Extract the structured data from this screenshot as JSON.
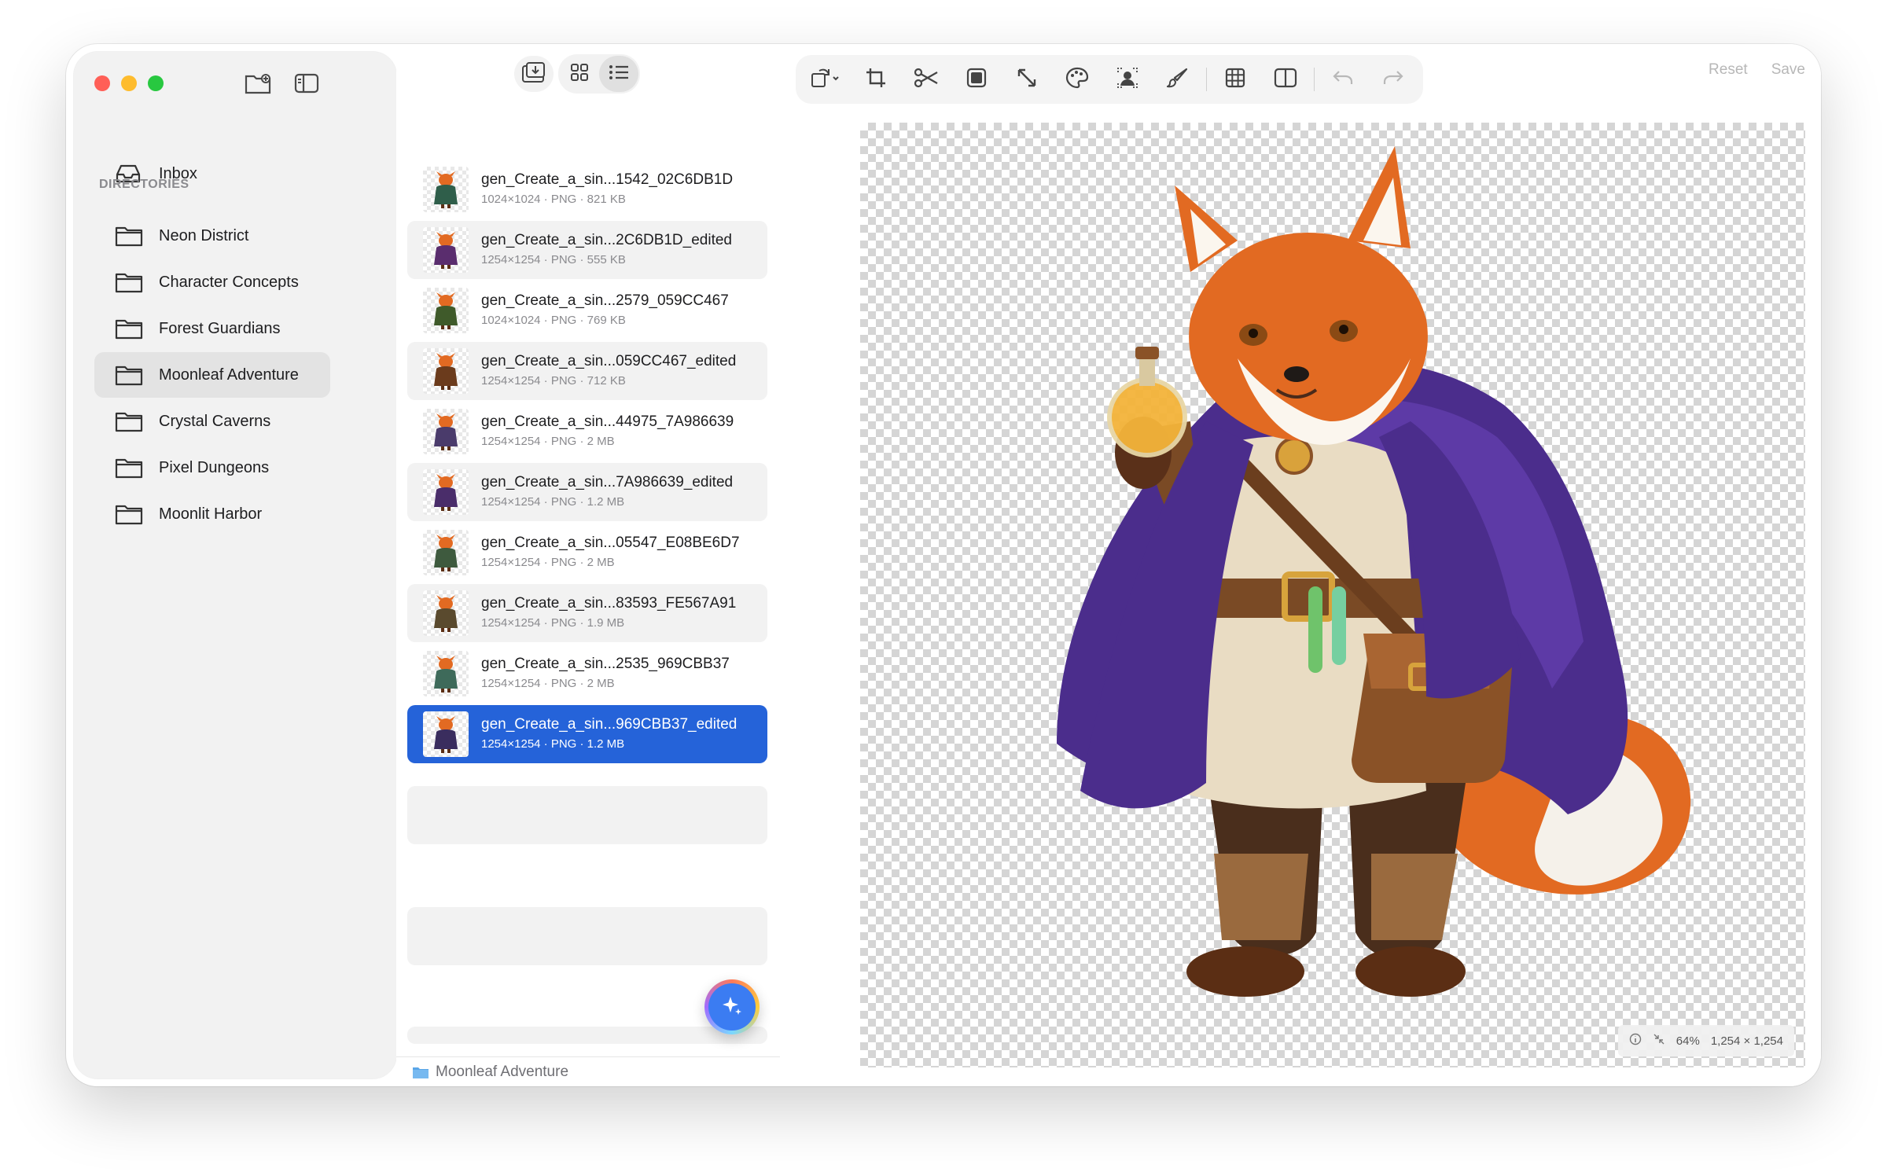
{
  "sidebar": {
    "inbox_label": "Inbox",
    "directories_header": "DIRECTORIES",
    "directories": [
      {
        "label": "Neon District"
      },
      {
        "label": "Character Concepts"
      },
      {
        "label": "Forest Guardians"
      },
      {
        "label": "Moonleaf Adventure",
        "active": true
      },
      {
        "label": "Crystal Caverns"
      },
      {
        "label": "Pixel Dungeons"
      },
      {
        "label": "Moonlit Harbor"
      }
    ]
  },
  "filelist": {
    "files": [
      {
        "name": "gen_Create_a_sin...1542_02C6DB1D",
        "meta": "1024×1024 · PNG · 821 KB"
      },
      {
        "name": "gen_Create_a_sin...2C6DB1D_edited",
        "meta": "1254×1254 · PNG · 555 KB"
      },
      {
        "name": "gen_Create_a_sin...2579_059CC467",
        "meta": "1024×1024 · PNG · 769 KB"
      },
      {
        "name": "gen_Create_a_sin...059CC467_edited",
        "meta": "1254×1254 · PNG · 712 KB"
      },
      {
        "name": "gen_Create_a_sin...44975_7A986639",
        "meta": "1254×1254 · PNG · 2 MB"
      },
      {
        "name": "gen_Create_a_sin...7A986639_edited",
        "meta": "1254×1254 · PNG · 1.2 MB"
      },
      {
        "name": "gen_Create_a_sin...05547_E08BE6D7",
        "meta": "1254×1254 · PNG · 2 MB"
      },
      {
        "name": "gen_Create_a_sin...83593_FE567A91",
        "meta": "1254×1254 · PNG · 1.9 MB"
      },
      {
        "name": "gen_Create_a_sin...2535_969CBB37",
        "meta": "1254×1254 · PNG · 2 MB"
      },
      {
        "name": "gen_Create_a_sin...969CBB37_edited",
        "meta": "1254×1254 · PNG · 1.2 MB"
      }
    ],
    "footer_folder": "Moonleaf Adventure"
  },
  "editor": {
    "reset_label": "Reset",
    "save_label": "Save",
    "zoom": "64%",
    "dimensions": "1,254 × 1,254"
  },
  "colors": {
    "selection": "#2563d9",
    "sidebar_bg": "#f2f2f2",
    "accent_fab": "#3b7cf2"
  }
}
